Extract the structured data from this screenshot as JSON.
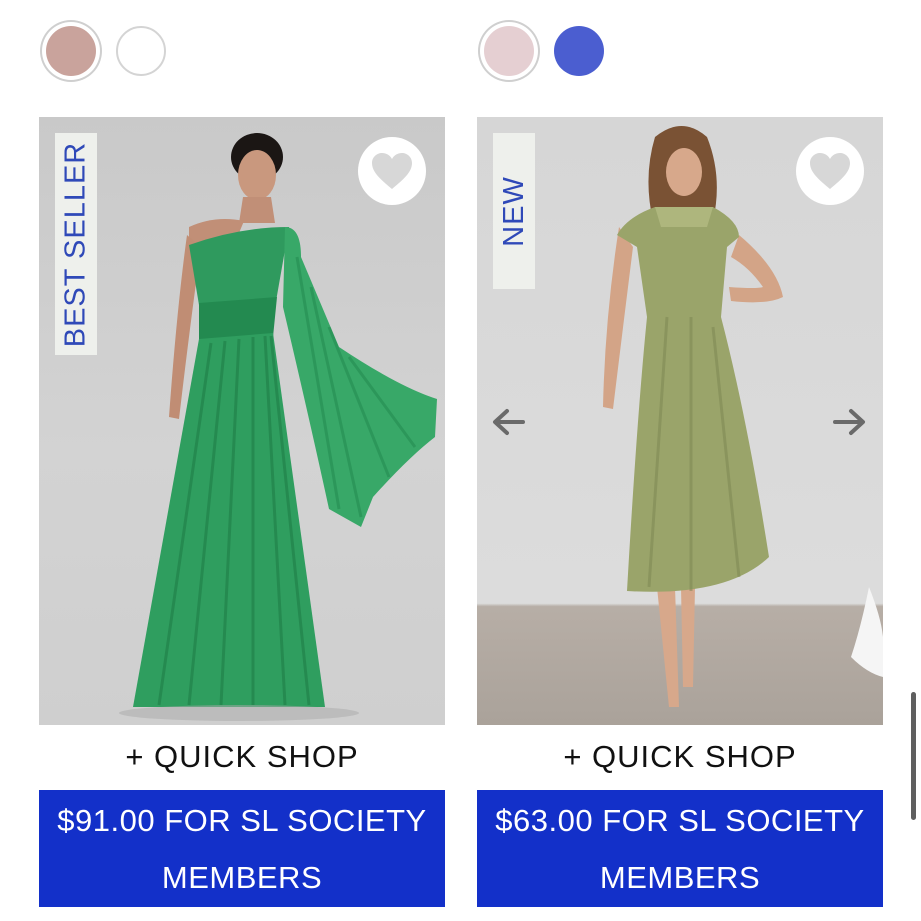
{
  "colors": {
    "accent_blue": "#1330c9",
    "badge_text": "#2f49b8",
    "swatch_rose": "#c9a39c",
    "swatch_white": "#ffffff",
    "swatch_blush": "#e5cfd2",
    "swatch_cobalt": "#4b5ed0"
  },
  "products": [
    {
      "badge": "BEST SELLER",
      "swatches": [
        {
          "name": "rose",
          "color": "#c9a39c",
          "selected": true
        },
        {
          "name": "white",
          "color": "#ffffff",
          "selected": false
        }
      ],
      "quick_shop": "+ QUICK SHOP",
      "price_line1": "$91.00 FOR SL SOCIETY",
      "price_line2": "MEMBERS",
      "icons": {
        "wishlist": "heart-icon"
      }
    },
    {
      "badge": "NEW",
      "swatches": [
        {
          "name": "blush",
          "color": "#e5cfd2",
          "selected": true
        },
        {
          "name": "cobalt",
          "color": "#4b5ed0",
          "selected": false
        }
      ],
      "quick_shop": "+ QUICK SHOP",
      "price_line1": "$63.00 FOR SL SOCIETY",
      "price_line2": "MEMBERS",
      "icons": {
        "wishlist": "heart-icon",
        "prev": "arrow-left-icon",
        "next": "arrow-right-icon"
      }
    }
  ]
}
